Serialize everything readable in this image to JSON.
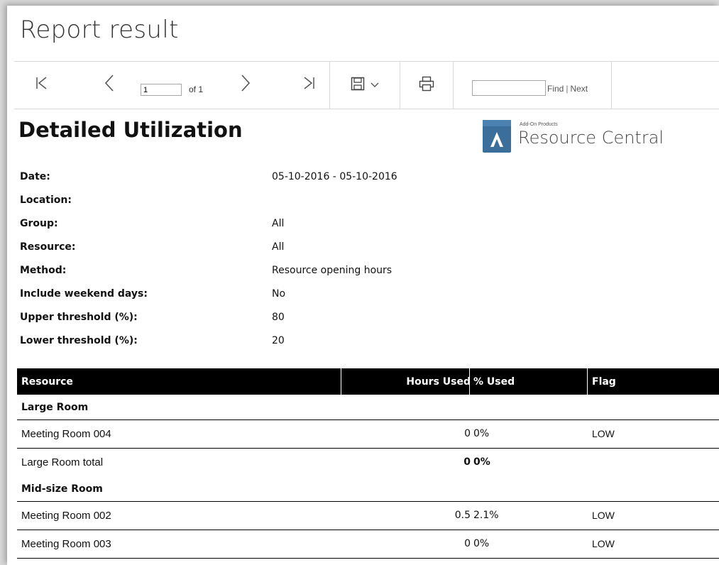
{
  "page": {
    "title": "Report result"
  },
  "toolbar": {
    "first_icon": "first-page-icon",
    "prev_icon": "previous-page-icon",
    "page_value": "1",
    "page_of": "of 1",
    "next_icon": "next-page-icon",
    "last_icon": "last-page-icon",
    "save_icon": "save-icon",
    "print_icon": "print-icon",
    "find_value": "",
    "find_label": "Find",
    "separator": "|",
    "next_label": "Next"
  },
  "report": {
    "title": "Detailed Utilization",
    "logo_small": "Add-On Products",
    "logo_name": "Resource Central",
    "logo_color": "#3b6e9a"
  },
  "params": [
    {
      "label": "Date:",
      "value": "05-10-2016 - 05-10-2016"
    },
    {
      "label": "Location:",
      "value": ""
    },
    {
      "label": "Group:",
      "value": "All"
    },
    {
      "label": "Resource:",
      "value": "All"
    },
    {
      "label": "Method:",
      "value": "Resource opening hours"
    },
    {
      "label": "Include weekend days:",
      "value": "No"
    },
    {
      "label": "Upper threshold (%):",
      "value": "80"
    },
    {
      "label": "Lower threshold (%):",
      "value": "20"
    }
  ],
  "table": {
    "headers": {
      "resource": "Resource",
      "hours": "Hours Used",
      "pct": "% Used",
      "flag": "Flag"
    },
    "groups": [
      {
        "name": "Large Room",
        "rows": [
          {
            "resource": "Meeting Room 004",
            "hours": "0",
            "pct": "0%",
            "flag": "LOW"
          }
        ],
        "total": {
          "resource": "Large Room total",
          "hours": "0",
          "pct": "0%"
        }
      },
      {
        "name": "Mid-size Room",
        "rows": [
          {
            "resource": "Meeting Room 002",
            "hours": "0.5",
            "pct": "2.1%",
            "flag": "LOW"
          },
          {
            "resource": "Meeting Room 003",
            "hours": "0",
            "pct": "0%",
            "flag": "LOW"
          }
        ]
      }
    ]
  }
}
